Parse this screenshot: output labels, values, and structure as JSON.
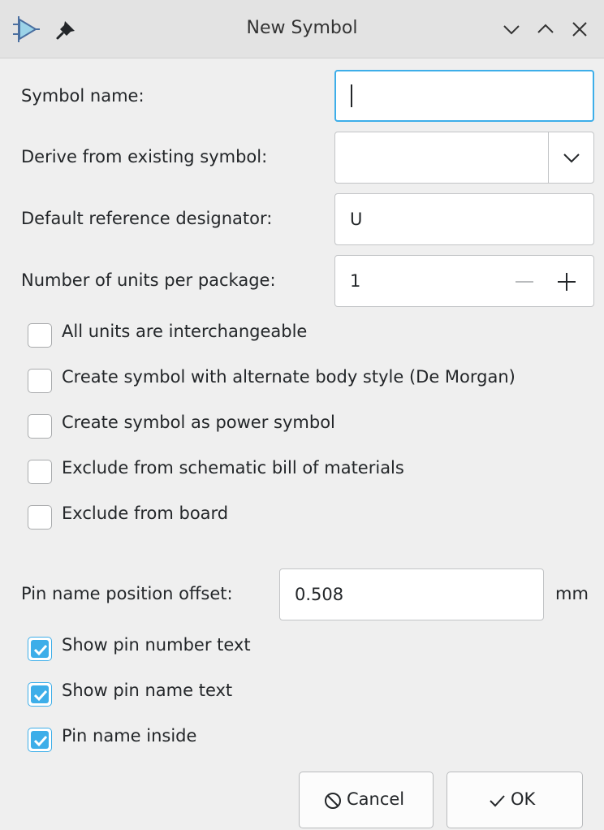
{
  "window": {
    "title": "New Symbol",
    "icons": {
      "app": "kicad-symbol-editor-icon",
      "pin": "pin-icon",
      "minimize": "chevron-down-icon",
      "maximize": "chevron-up-icon",
      "close": "close-icon"
    }
  },
  "form": {
    "symbol_name": {
      "label": "Symbol name:",
      "value": ""
    },
    "derive_from": {
      "label": "Derive from existing symbol:",
      "value": ""
    },
    "reference_designator": {
      "label": "Default reference designator:",
      "value": "U"
    },
    "units_per_package": {
      "label": "Number of units per package:",
      "value": "1"
    }
  },
  "checkboxes": [
    {
      "label": "All units are interchangeable",
      "checked": false
    },
    {
      "label": "Create symbol with alternate body style (De Morgan)",
      "checked": false
    },
    {
      "label": "Create symbol as power symbol",
      "checked": false
    },
    {
      "label": "Exclude from schematic bill of materials",
      "checked": false
    },
    {
      "label": "Exclude from board",
      "checked": false
    }
  ],
  "pin_offset": {
    "label": "Pin name position offset:",
    "value": "0.508",
    "unit": "mm"
  },
  "pin_checkboxes": [
    {
      "label": "Show pin number text",
      "checked": true
    },
    {
      "label": "Show pin name text",
      "checked": true
    },
    {
      "label": "Pin name inside",
      "checked": true
    }
  ],
  "buttons": {
    "cancel": "Cancel",
    "ok": "OK"
  },
  "colors": {
    "accent": "#3daee9",
    "background": "#efefef",
    "titlebar": "#e3e3e3"
  }
}
